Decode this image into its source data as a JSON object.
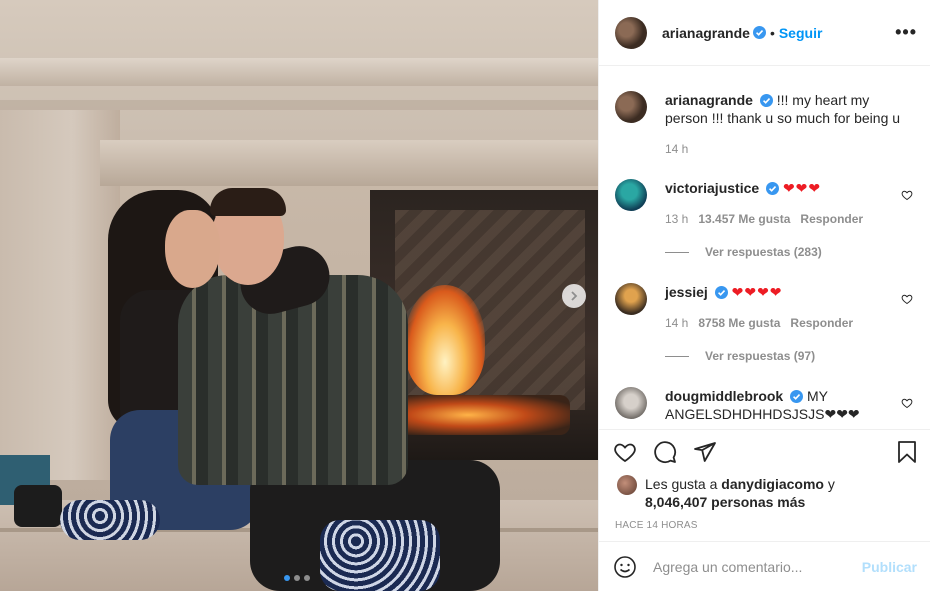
{
  "post": {
    "carousel": {
      "slides": 3,
      "active": 1
    }
  },
  "header": {
    "username": "arianagrande",
    "separator": "•",
    "follow_label": "Seguir",
    "more_label": "•••"
  },
  "caption": {
    "username": "arianagrande",
    "text": "!!! my heart my person !!! thank u so much for being u",
    "time": "14 h"
  },
  "comments": [
    {
      "username": "victoriajustice",
      "text": "❤❤❤",
      "time": "13 h",
      "likes": "13.457 Me gusta",
      "reply": "Responder",
      "view_replies": "Ver respuestas (283)"
    },
    {
      "username": "jessiej",
      "text": "❤❤❤❤",
      "time": "14 h",
      "likes": "8758 Me gusta",
      "reply": "Responder",
      "view_replies": "Ver respuestas (97)"
    },
    {
      "username": "dougmiddlebrook",
      "text": "MY ANGELSDHDHHDSJSJS❤❤❤"
    }
  ],
  "likes": {
    "prefix": "Les gusta a",
    "user": "danydigiacomo",
    "suffix": "y",
    "others": "8,046,407 personas más"
  },
  "timeago": "HACE 14 HORAS",
  "add_comment": {
    "placeholder": "Agrega un comentario...",
    "publish_label": "Publicar"
  },
  "colors": {
    "accent": "#0095f6",
    "verified": "#3897f0",
    "muted": "#8e8e8e",
    "heart": "#ed1c24",
    "publish_disabled": "#b2dffc"
  }
}
